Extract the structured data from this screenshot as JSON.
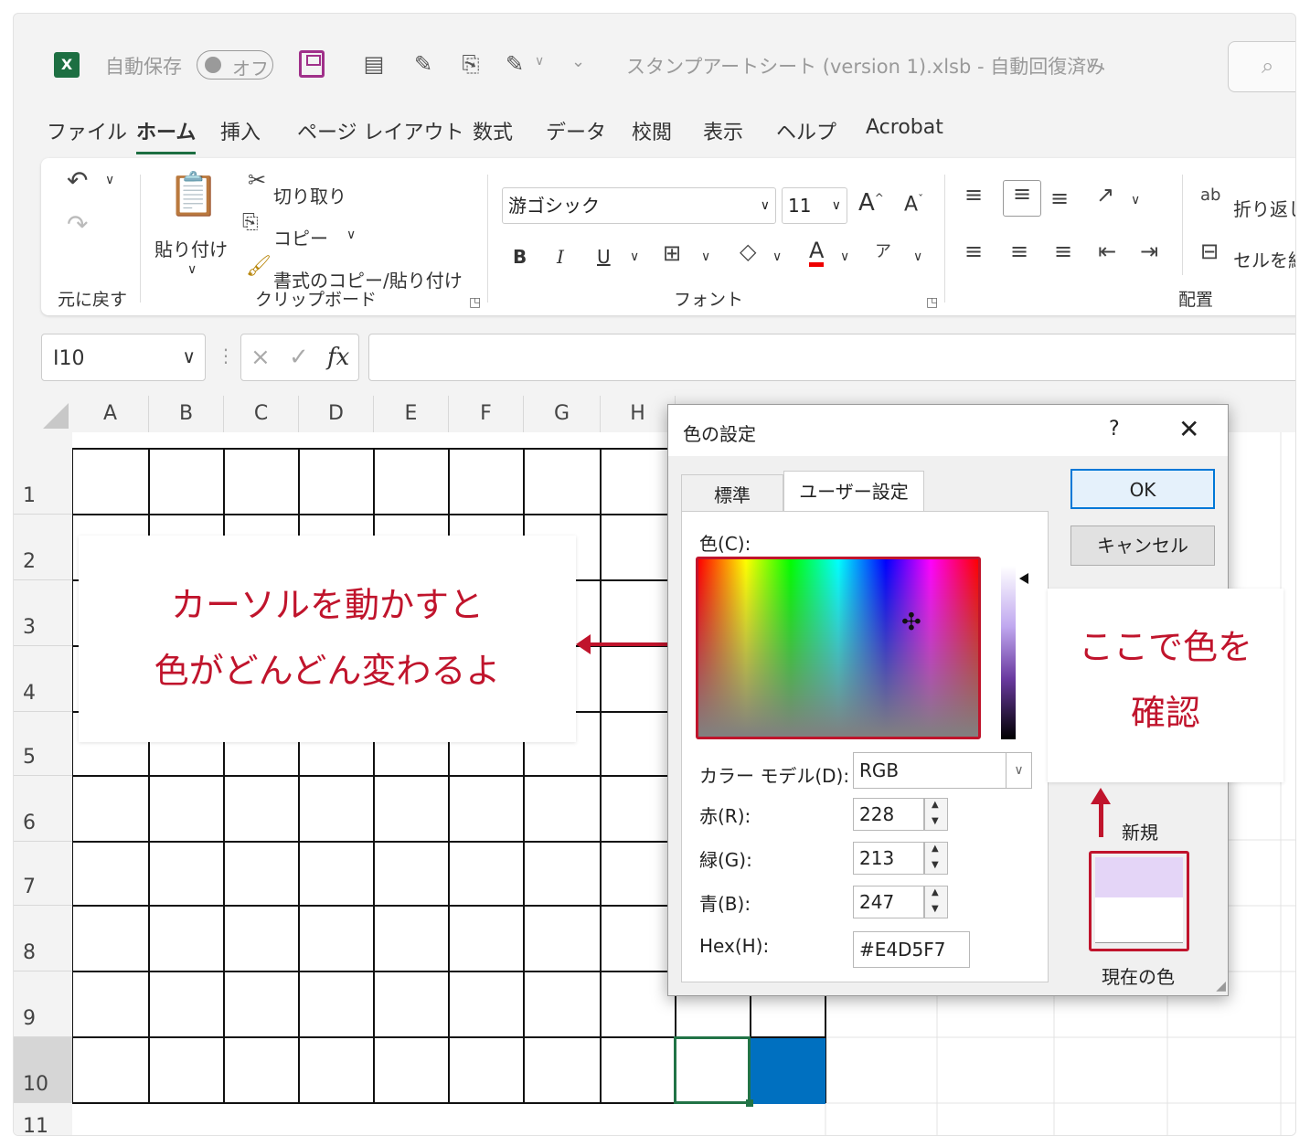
{
  "titlebar": {
    "autosave_label": "自動保存",
    "toggle_label": "オフ",
    "file_title": "スタンプアートシート (version 1).xlsb  -  自動回復済み",
    "title_chevron": "∨"
  },
  "menu": {
    "tabs": [
      "ファイル",
      "ホーム",
      "挿入",
      "ページ レイアウト",
      "数式",
      "データ",
      "校閲",
      "表示",
      "ヘルプ",
      "Acrobat"
    ],
    "active_tab": "ホーム"
  },
  "ribbon": {
    "undo_group": "元に戻す",
    "clipboard": {
      "paste": "貼り付け",
      "cut": "切り取り",
      "copy": "コピー",
      "format_painter": "書式のコピー/貼り付け",
      "group": "クリップボード"
    },
    "font": {
      "name": "游ゴシック",
      "size": "11",
      "bold": "B",
      "italic": "I",
      "underline": "U",
      "group": "フォント"
    },
    "alignment": {
      "wrap_text": "折り返し",
      "merge": "セルを結",
      "group": "配置"
    }
  },
  "formula_bar": {
    "cell_ref": "I10",
    "fx": "fx",
    "cancel": "×",
    "enter": "✓",
    "value": ""
  },
  "sheet": {
    "columns": [
      "A",
      "B",
      "C",
      "D",
      "E",
      "F",
      "G",
      "H"
    ],
    "rows": [
      "1",
      "2",
      "3",
      "4",
      "5",
      "6",
      "7",
      "8",
      "9",
      "10",
      "11"
    ],
    "selected_row": "10",
    "fill_color": "#0070c0"
  },
  "callouts": {
    "left_line1": "カーソルを動かすと",
    "left_line2": "色がどんどん変わるよ",
    "right_line1": "ここで色を",
    "right_line2": "確認",
    "accent_color": "#c0142c"
  },
  "dialog": {
    "title": "色の設定",
    "help": "?",
    "close": "✕",
    "tab_standard": "標準",
    "tab_custom": "ユーザー設定",
    "color_label": "色(C):",
    "color_model_label": "カラー モデル(D):",
    "color_model_value": "RGB",
    "red_label": "赤(R):",
    "red_value": "228",
    "green_label": "緑(G):",
    "green_value": "213",
    "blue_label": "青(B):",
    "blue_value": "247",
    "hex_label": "Hex(H):",
    "hex_value": "#E4D5F7",
    "ok": "OK",
    "cancel": "キャンセル",
    "new_label": "新規",
    "current_label": "現在の色",
    "new_color": "#e4d5f7",
    "current_color": "#ffffff"
  }
}
